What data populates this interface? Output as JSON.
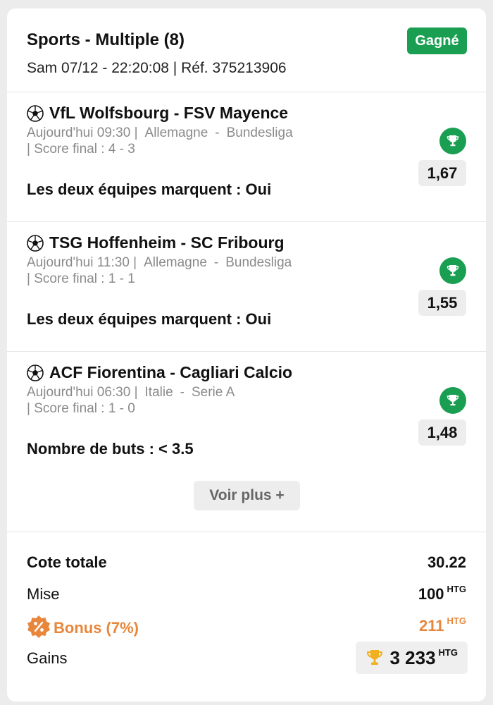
{
  "bet": {
    "title": "Sports - Multiple (8)",
    "meta": "Sam 07/12 - 22:20:08 | Réf. 375213906",
    "status": "Gagné"
  },
  "matches": [
    {
      "teams": "VfL Wolfsbourg - FSV Mayence",
      "time": "Aujourd'hui 09:30 |",
      "country": "Allemagne",
      "sep": "-",
      "league": "Bundesliga",
      "score": "| Score final : 4 - 3",
      "market": "Les deux équipes marquent : Oui",
      "odds": "1,67"
    },
    {
      "teams": "TSG Hoffenheim - SC Fribourg",
      "time": "Aujourd'hui 11:30 |",
      "country": "Allemagne",
      "sep": "-",
      "league": "Bundesliga",
      "score": "| Score final : 1 - 1",
      "market": "Les deux équipes marquent : Oui",
      "odds": "1,55"
    },
    {
      "teams": "ACF Fiorentina - Cagliari Calcio",
      "time": "Aujourd'hui 06:30 |",
      "country": "Italie",
      "sep": "-",
      "league": "Serie A",
      "score": "| Score final : 1 - 0",
      "market": "Nombre de buts : < 3.5",
      "odds": "1,48"
    }
  ],
  "see_more": "Voir plus +",
  "totals": {
    "total_odds_label": "Cote totale",
    "total_odds_value": "30.22",
    "stake_label": "Mise",
    "stake_value": "100",
    "bonus_label": "Bonus (7%)",
    "bonus_value": "211",
    "gains_label": "Gains",
    "gains_value": "3 233",
    "currency": "HTG"
  },
  "icons": {
    "ball": "soccer-ball-icon",
    "trophy": "trophy-icon",
    "bonus": "percent-badge-icon"
  },
  "colors": {
    "won": "#1a9f52",
    "bonus": "#e8873c",
    "gains_trophy": "#f2b01e"
  }
}
